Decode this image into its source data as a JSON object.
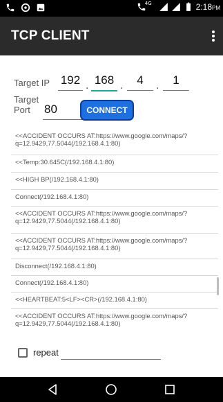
{
  "status_bar": {
    "time": "2:18",
    "time_suffix": "PM",
    "network_badge": "4G",
    "left_icons": [
      "phone-icon",
      "target-icon",
      "image-icon"
    ]
  },
  "app_bar": {
    "title": "TCP CLIENT",
    "overflow_icon": "more-vert-icon"
  },
  "target_ip": {
    "label": "Target IP",
    "octets": [
      "192",
      "168",
      "4",
      "1"
    ],
    "separator": "."
  },
  "target_port": {
    "label": "Target\nPort",
    "value": "80"
  },
  "connect_button": {
    "label": "CONNECT",
    "color": "#1e6fe0"
  },
  "log": [
    "<<ACCIDENT OCCURS AT:https://www.google.com/maps/?q=12.9429,77.5044(/192.168.4.1:80)",
    "<<Temp:30.645C(/192.168.4.1:80)",
    "<<HIGH BP(/192.168.4.1:80)",
    "Connect(/192.168.4.1:80)",
    "<<ACCIDENT OCCURS AT:https://www.google.com/maps/?q=12.9429,77.5044(/192.168.4.1:80)",
    "<<ACCIDENT OCCURS AT:https://www.google.com/maps/?q=12.9429,77.5044(/192.168.4.1:80)",
    "Disconnect(/192.168.4.1:80)",
    "Connect(/192.168.4.1:80)",
    "<<HEARTBEAT:5<LF><CR>(/192.168.4.1:80)",
    "<<ACCIDENT OCCURS AT:https://www.google.com/maps/?q=12.9429,77.5044(/192.168.4.1:80)"
  ],
  "repeat": {
    "label": "repeat",
    "checked": false,
    "value": ""
  },
  "nav_bar": {
    "buttons": [
      "back-icon",
      "home-icon",
      "recents-icon"
    ]
  },
  "colors": {
    "app_bar": "#2b2b2b",
    "accent": "#1aa89a",
    "button_border": "#0c3d9c"
  }
}
